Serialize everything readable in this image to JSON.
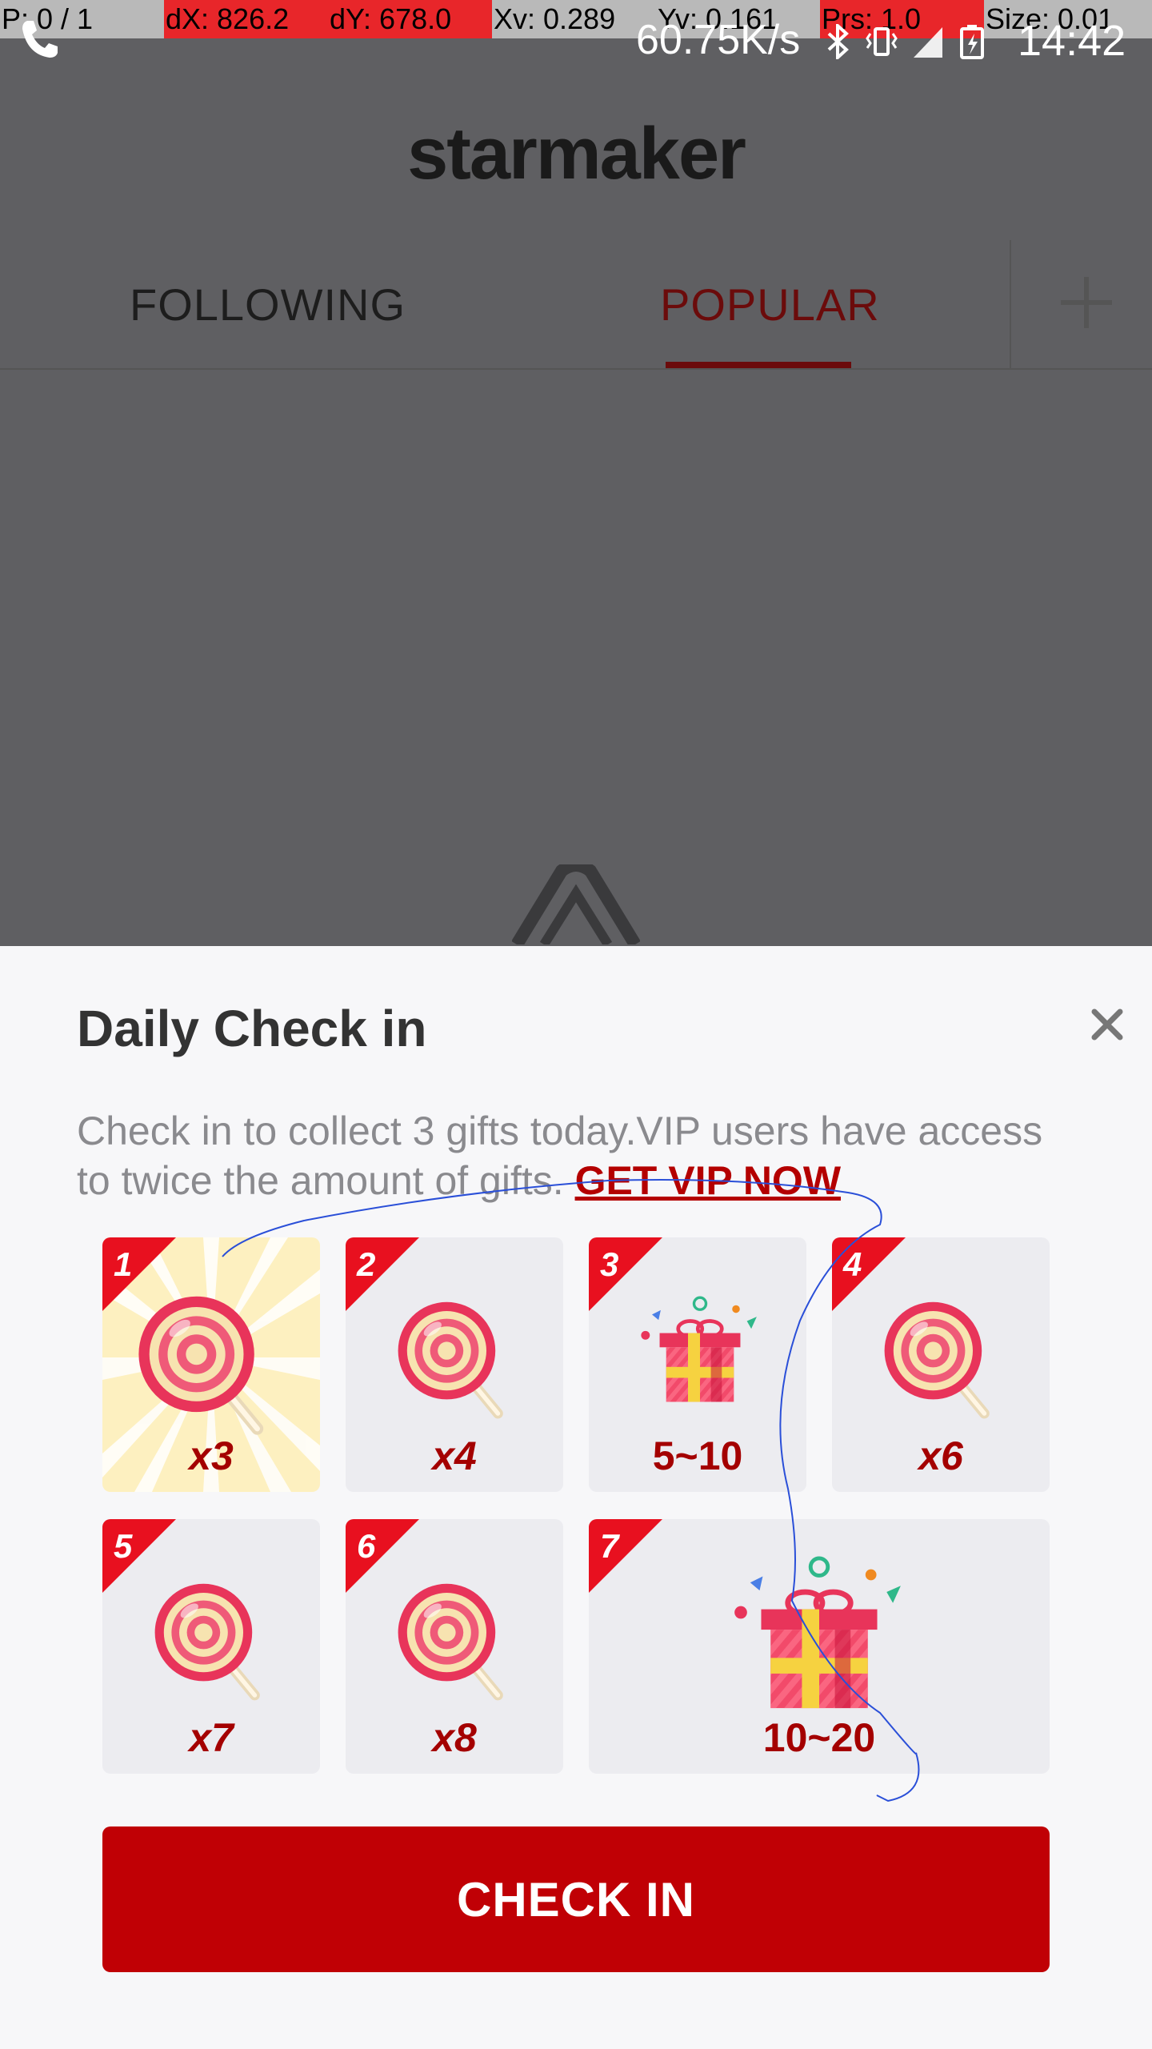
{
  "debug_overlay": {
    "pointer": "P: 0 / 1",
    "dx": "dX: 826.2",
    "dy": "dY: 678.0",
    "xv": "Xv: 0.289",
    "yv": "Yv: 0.161",
    "prs": "Prs: 1.0",
    "size": "Size: 0.01"
  },
  "status_bar": {
    "network_speed": "60.75K/s",
    "time": "14:42",
    "icons": [
      "phone-icon",
      "bluetooth-icon",
      "vibrate-icon",
      "signal-icon",
      "battery-icon"
    ]
  },
  "header": {
    "logo": "starmaker"
  },
  "tabs": [
    {
      "label": "FOLLOWING",
      "active": false
    },
    {
      "label": "POPULAR",
      "active": true
    }
  ],
  "checkin": {
    "title": "Daily Check in",
    "description": "Check in to collect 3 gifts today.VIP users have access to twice the amount of gifts.",
    "vip_link": "GET VIP NOW",
    "button": "CHECK IN",
    "days": [
      {
        "day": "1",
        "reward": "x3",
        "icon": "lollipop-icon",
        "today": true
      },
      {
        "day": "2",
        "reward": "x4",
        "icon": "lollipop-icon"
      },
      {
        "day": "3",
        "reward": "5~10",
        "icon": "gift-box-icon"
      },
      {
        "day": "4",
        "reward": "x6",
        "icon": "lollipop-icon"
      },
      {
        "day": "5",
        "reward": "x7",
        "icon": "lollipop-icon"
      },
      {
        "day": "6",
        "reward": "x8",
        "icon": "lollipop-icon"
      },
      {
        "day": "7",
        "reward": "10~20",
        "icon": "gift-box-icon"
      }
    ]
  },
  "colors": {
    "accent": "#c00005",
    "ribbon": "#e8101f",
    "reward_text": "#a40000",
    "active_tab": "#6b0b0b"
  }
}
